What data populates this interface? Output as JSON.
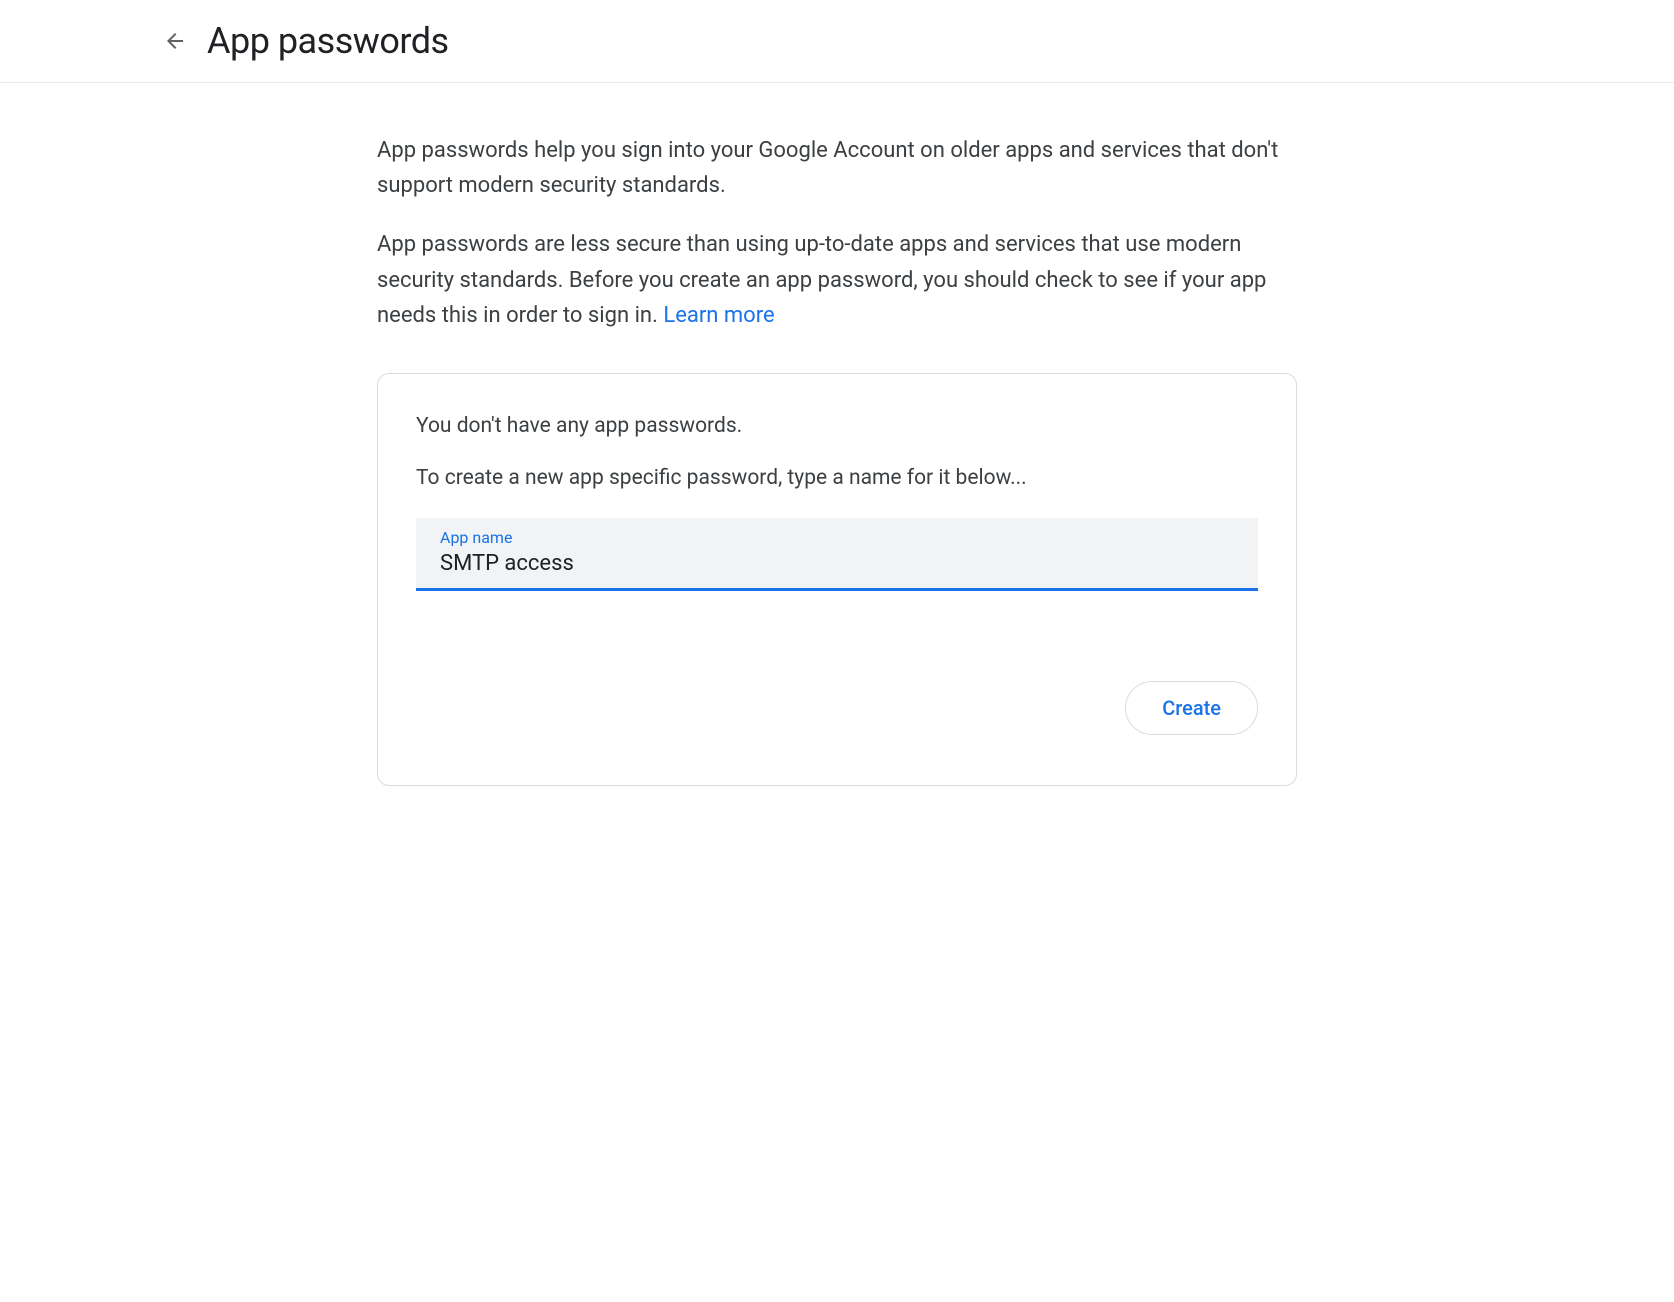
{
  "header": {
    "title": "App passwords"
  },
  "description": {
    "paragraph1": "App passwords help you sign into your Google Account on older apps and services that don't support modern security standards.",
    "paragraph2": "App passwords are less secure than using up-to-date apps and services that use modern security standards. Before you create an app password, you should check to see if your app needs this in order to sign in.",
    "learn_more_label": "Learn more"
  },
  "card": {
    "no_passwords_text": "You don't have any app passwords.",
    "instruction_text": "To create a new app specific password, type a name for it below...",
    "input_label": "App name",
    "input_value": "SMTP access",
    "create_button_label": "Create"
  }
}
